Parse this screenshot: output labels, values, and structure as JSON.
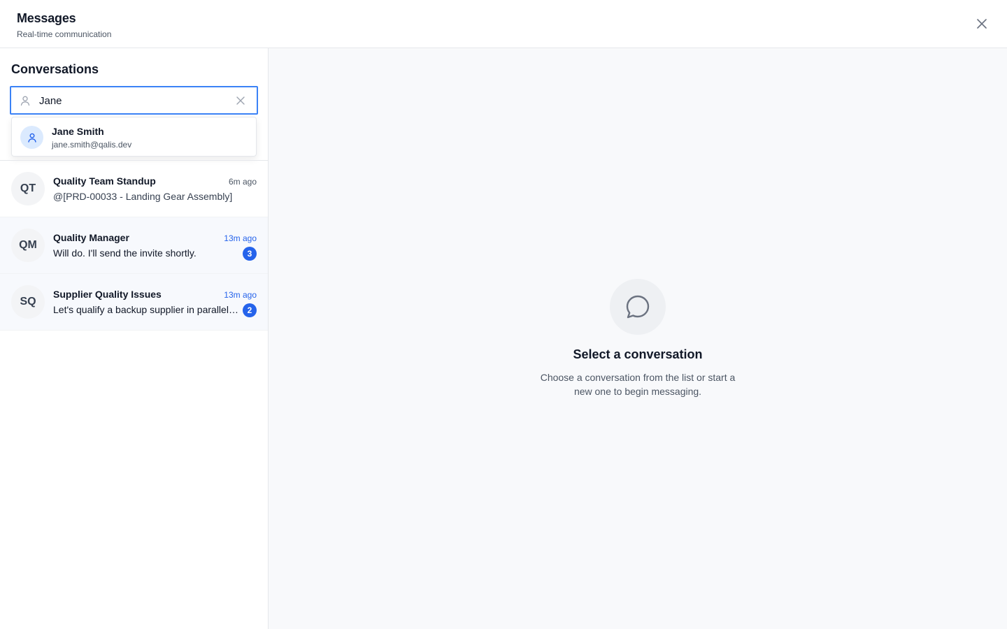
{
  "header": {
    "title": "Messages",
    "subtitle": "Real-time communication"
  },
  "sidebar": {
    "heading": "Conversations",
    "search": {
      "value": "Jane",
      "placeholder": ""
    },
    "suggestion": {
      "name": "Jane Smith",
      "email": "jane.smith@qalis.dev"
    },
    "conversations": [
      {
        "initials": "QT",
        "name": "Quality Team Standup",
        "time": "6m ago",
        "preview": "@[PRD-00033 - Landing Gear Assembly]",
        "unread": ""
      },
      {
        "initials": "QM",
        "name": "Quality Manager",
        "time": "13m ago",
        "preview": "Will do. I'll send the invite shortly.",
        "unread": "3"
      },
      {
        "initials": "SQ",
        "name": "Supplier Quality Issues",
        "time": "13m ago",
        "preview": "Let's qualify a backup supplier in parallel. Can you reach out to our secondary vendor?",
        "unread": "2"
      }
    ]
  },
  "main": {
    "empty_title": "Select a conversation",
    "empty_description": "Choose a conversation from the list or start a new one to begin messaging."
  },
  "icons": {
    "close": "close-icon",
    "search_user": "user-icon",
    "clear": "clear-icon",
    "suggestion_avatar": "user-icon",
    "empty_state": "message-circle-icon"
  },
  "colors": {
    "accent": "#2563eb",
    "focus_border": "#3b82f6",
    "unread_bg": "#f7f9fd",
    "main_bg": "#f8f9fb"
  }
}
